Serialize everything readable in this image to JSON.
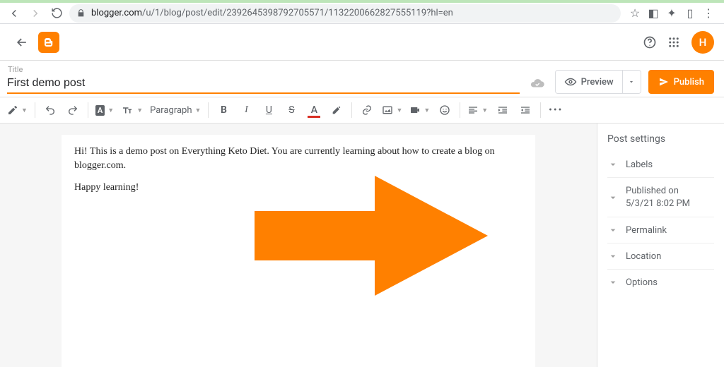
{
  "browser": {
    "url_host": "blogger.com",
    "url_path": "/u/1/blog/post/edit/2392645398792705571/1132200662827555119?hl=en"
  },
  "appbar": {
    "avatar_letter": "H"
  },
  "title": {
    "label": "Title",
    "value": "First demo post"
  },
  "actions": {
    "preview": "Preview",
    "publish": "Publish"
  },
  "toolbar": {
    "paragraph": "Paragraph",
    "bold": "B",
    "italic": "I",
    "underline": "U",
    "strike": "S",
    "textcolor": "A",
    "more": "•••"
  },
  "content": {
    "p1": "Hi! This is a demo post on Everything Keto Diet. You are currently learning about how to create a blog on blogger.com.",
    "p2": "Happy learning!"
  },
  "sidebar": {
    "heading": "Post settings",
    "labels": "Labels",
    "published_line1": "Published on",
    "published_line2": "5/3/21 8:02 PM",
    "permalink": "Permalink",
    "location": "Location",
    "options": "Options"
  }
}
